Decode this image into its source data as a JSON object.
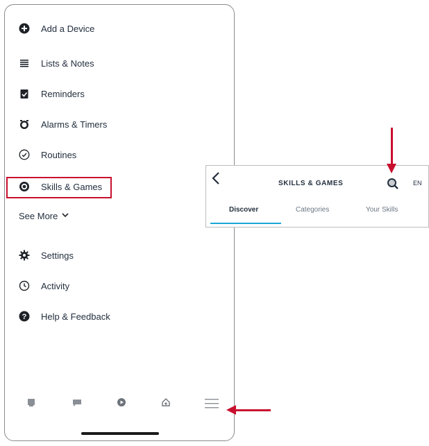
{
  "menu": {
    "items": [
      {
        "label": "Add a Device",
        "icon": "plus-circle-icon"
      },
      {
        "label": "Lists & Notes",
        "icon": "list-icon"
      },
      {
        "label": "Reminders",
        "icon": "clipboard-check-icon"
      },
      {
        "label": "Alarms & Timers",
        "icon": "alarm-clock-icon"
      },
      {
        "label": "Routines",
        "icon": "routines-check-icon"
      },
      {
        "label": "Skills & Games",
        "icon": "skills-icon"
      },
      {
        "label": "Settings",
        "icon": "gear-icon"
      },
      {
        "label": "Activity",
        "icon": "history-icon"
      },
      {
        "label": "Help & Feedback",
        "icon": "help-icon"
      }
    ],
    "see_more": "See More",
    "highlighted_item": "Skills & Games"
  },
  "bottom_nav": {
    "items": [
      {
        "icon": "home-icon"
      },
      {
        "icon": "communicate-icon"
      },
      {
        "icon": "play-icon"
      },
      {
        "icon": "devices-icon"
      },
      {
        "icon": "more-menu-icon"
      }
    ]
  },
  "skills_header": {
    "back_icon": "back-chevron-icon",
    "title": "SKILLS & GAMES",
    "search_icon": "search-icon",
    "language": "EN",
    "tabs": [
      {
        "label": "Discover",
        "active": true
      },
      {
        "label": "Categories",
        "active": false
      },
      {
        "label": "Your Skills",
        "active": false
      }
    ]
  },
  "colors": {
    "annotation_red": "#c8102e",
    "active_tab_underline": "#1aa7d8",
    "text_dark": "#232f3e"
  }
}
